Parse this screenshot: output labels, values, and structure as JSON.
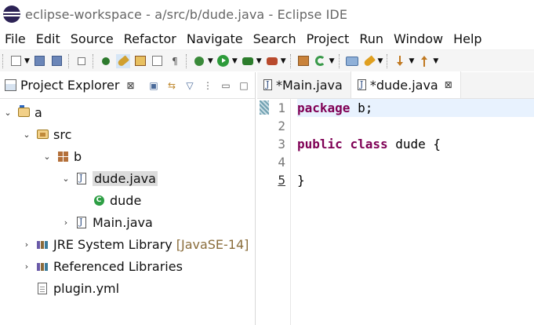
{
  "window": {
    "title": "eclipse-workspace - a/src/b/dude.java - Eclipse IDE"
  },
  "menu": [
    "File",
    "Edit",
    "Source",
    "Refactor",
    "Navigate",
    "Search",
    "Project",
    "Run",
    "Window",
    "Help"
  ],
  "explorer": {
    "tab_label": "Project Explorer",
    "close_glyph": "⊠",
    "tree": {
      "project": "a",
      "src": "src",
      "package": "b",
      "dude_file": "dude.java",
      "dude_class": "dude",
      "main_file": "Main.java",
      "jre_label": "JRE System Library",
      "jre_version": "[JavaSE-14]",
      "ref_libs": "Referenced Libraries",
      "plugin": "plugin.yml"
    }
  },
  "editor": {
    "tabs": [
      {
        "label": "*Main.java",
        "active": false
      },
      {
        "label": "*dude.java",
        "active": true
      }
    ],
    "close_glyph": "⊠",
    "line_numbers": [
      "1",
      "2",
      "3",
      "4",
      "5"
    ],
    "lines": {
      "l1_kw": "package",
      "l1_rest": " b;",
      "l3_kw1": "public",
      "l3_kw2": "class",
      "l3_rest": " dude {",
      "l5": "}"
    }
  },
  "icons": {
    "accent": "#7f0055",
    "highlight": "#e8f2fe",
    "selection": "#dcdcdc"
  }
}
